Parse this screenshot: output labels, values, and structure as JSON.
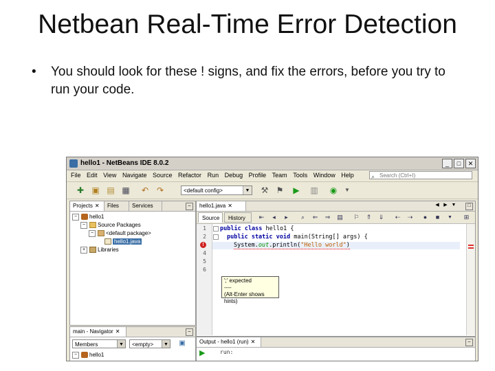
{
  "slide": {
    "title": "Netbean Real-Time Error Detection",
    "bullet": "You should look for these ! signs, and fix the errors, before you try to run your code."
  },
  "ide": {
    "window_title": "hello1 - NetBeans IDE 8.0.2",
    "menu": [
      "File",
      "Edit",
      "View",
      "Navigate",
      "Source",
      "Refactor",
      "Run",
      "Debug",
      "Profile",
      "Team",
      "Tools",
      "Window",
      "Help"
    ],
    "search_placeholder": "Search (Ctrl+I)",
    "config_value": "<default config>",
    "projects_tabs": [
      "Projects",
      "Files",
      "Services"
    ],
    "tree": {
      "project": "hello1",
      "source_packages": "Source Packages",
      "default_package": "<default package>",
      "file": "hello1.java",
      "libraries": "Libraries"
    },
    "navigator": {
      "tab": "main - Navigator",
      "members": "Members",
      "filter": "<empty>",
      "item": "hello1"
    },
    "editor": {
      "tab": "hello1.java",
      "source_tab": "Source",
      "history_tab": "History",
      "line_numbers": [
        "1",
        "2",
        "3",
        "4",
        "5",
        "6"
      ],
      "line1_kw": "public class",
      "line1_rest": " hello1 {",
      "line2_kw": "public static void",
      "line2_rest": " main(String[] args) {",
      "line3_obj": "System.",
      "line3_field": "out",
      "line3_method": ".println(",
      "line3_string": "\"Hello world\"",
      "line3_close": ")",
      "error_glyph": "!",
      "tooltip_lines": [
        "';' expected",
        "----",
        "(Alt-Enter shows hints)"
      ]
    },
    "output": {
      "tab": "Output - hello1 (run)",
      "text": "run:"
    }
  }
}
